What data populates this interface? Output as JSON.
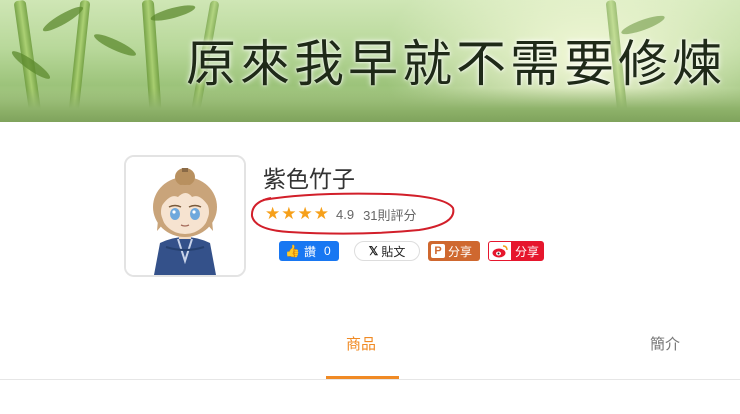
{
  "banner": {
    "title": "原來我早就不需要修煉"
  },
  "profile": {
    "name": "紫色竹子",
    "rating": {
      "stars": 4,
      "value": "4.9",
      "count_text": "31則評分"
    }
  },
  "share": {
    "facebook": {
      "label": "讚",
      "count": "0"
    },
    "x": {
      "label": "貼文"
    },
    "plurk": {
      "label": "分享"
    },
    "weibo": {
      "label": "分享"
    }
  },
  "tabs": [
    {
      "label": "商品",
      "active": true
    },
    {
      "label": "簡介",
      "active": false
    }
  ],
  "colors": {
    "accent": "#f08a24",
    "star": "#f6a01a",
    "annotation": "#d21f2a",
    "facebook": "#1877f2",
    "plurk": "#cf682f",
    "weibo": "#e6162d"
  }
}
